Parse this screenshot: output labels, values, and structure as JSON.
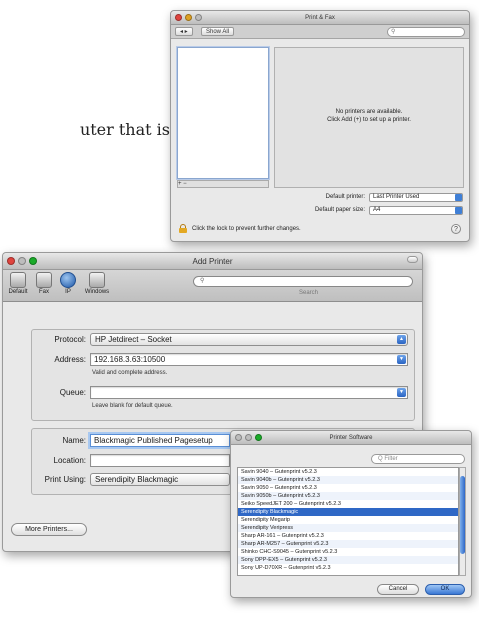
{
  "document": {
    "body_fragment": "uter that is"
  },
  "print_fax": {
    "title": "Print & Fax",
    "show_all": "Show All",
    "nav_back_forward": "◂ ▸",
    "no_printers_line1": "No printers are available.",
    "no_printers_line2": "Click Add (+) to set up a printer.",
    "list_controls": "+ −",
    "default_printer_label": "Default printer:",
    "default_printer_value": "Last Printer Used",
    "default_paper_label": "Default paper size:",
    "default_paper_value": "A4",
    "lock_text": "Click the lock to prevent further changes.",
    "help": "?"
  },
  "add_printer": {
    "title": "Add Printer",
    "toolbar": [
      {
        "label": "Default"
      },
      {
        "label": "Fax"
      },
      {
        "label": "IP"
      },
      {
        "label": "Windows"
      }
    ],
    "search_label": "Search",
    "protocol_label": "Protocol:",
    "protocol_value": "HP Jetdirect – Socket",
    "address_label": "Address:",
    "address_value": "192.168.3.63:10500",
    "address_hint": "Valid and complete address.",
    "queue_label": "Queue:",
    "queue_value": "",
    "queue_hint": "Leave blank for default queue.",
    "name_label": "Name:",
    "name_value": "Blackmagic Published Pagesetup",
    "location_label": "Location:",
    "location_value": "",
    "print_using_label": "Print Using:",
    "print_using_value": "Serendipity Blackmagic",
    "more_printers": "More Printers..."
  },
  "printer_software": {
    "title": "Printer Software",
    "search_placeholder": "Q Filter",
    "items": [
      "Savin 9040 – Gutenprint v5.2.3",
      "Savin 9040b – Gutenprint v5.2.3",
      "Savin 9050 – Gutenprint v5.2.3",
      "Savin 9050b – Gutenprint v5.2.3",
      "Seiko SpeedJET 200 – Gutenprint v5.2.3",
      "Serendipity Blackmagic",
      "Serendipity Megarip",
      "Serendipity Veripress",
      "Sharp AR-161 – Gutenprint v5.2.3",
      "Sharp AR-M257 – Gutenprint v5.2.3",
      "Shinko CHC-S9045 – Gutenprint v5.2.3",
      "Sony DPP-EX5 – Gutenprint v5.2.3",
      "Sony UP-D70XR – Gutenprint v5.2.3"
    ],
    "selected_index": 5,
    "cancel": "Cancel",
    "ok": "OK"
  }
}
